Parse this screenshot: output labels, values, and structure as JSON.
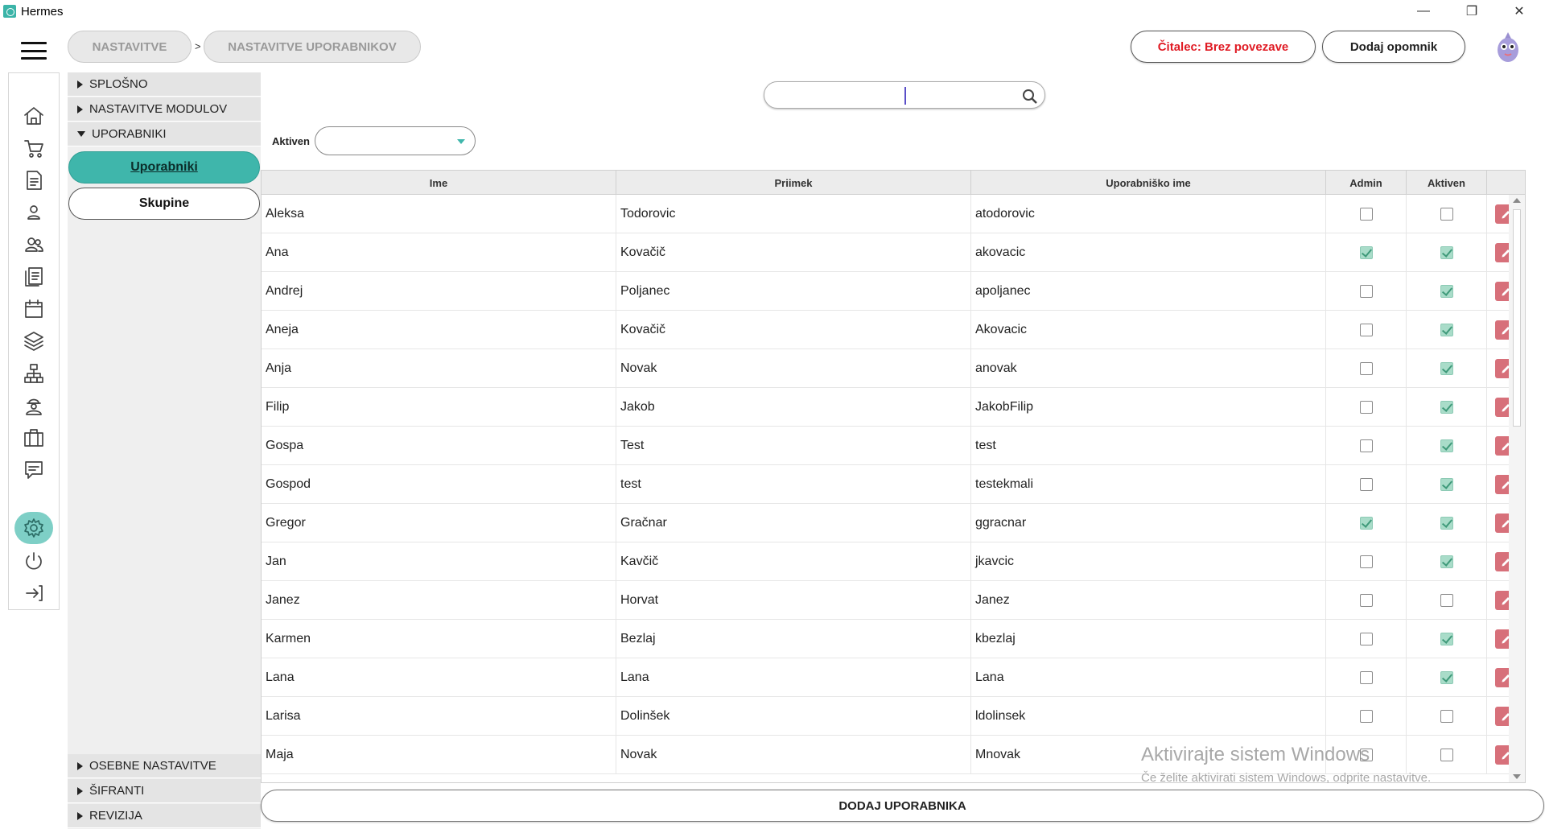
{
  "window": {
    "title": "Hermes"
  },
  "header": {
    "breadcrumb": [
      "NASTAVITVE",
      "NASTAVITVE UPORABNIKOV"
    ],
    "separator": ">",
    "reader_status": "Čitalec: Brez povezave",
    "add_reminder": "Dodaj opomnik"
  },
  "rail": {
    "icons": [
      "home-icon",
      "cart-icon",
      "document-icon",
      "user-icon",
      "users-icon",
      "list-icon",
      "calendar-icon",
      "layers-icon",
      "network-icon",
      "worker-icon",
      "briefcase-icon",
      "chat-icon",
      "gear-icon",
      "power-icon",
      "logout-icon"
    ],
    "active": "gear-icon"
  },
  "menu": {
    "sections_top": [
      "SPLOŠNO",
      "NASTAVITVE MODULOV",
      "UPORABNIKI"
    ],
    "expanded": "UPORABNIKI",
    "sub_items": [
      "Uporabniki",
      "Skupine"
    ],
    "active_sub": "Uporabniki",
    "sections_bottom": [
      "OSEBNE NASTAVITVE",
      "ŠIFRANTI",
      "REVIZIJA"
    ]
  },
  "filters": {
    "search_value": "",
    "aktiven_label": "Aktiven",
    "aktiven_value": ""
  },
  "table": {
    "columns": [
      "Ime",
      "Priimek",
      "Uporabniško ime",
      "Admin",
      "Aktiven"
    ],
    "rows": [
      {
        "ime": "Aleksa",
        "priimek": "Todorovic",
        "uporabnisko_ime": "atodorovic",
        "admin": false,
        "aktiven": false
      },
      {
        "ime": "Ana",
        "priimek": "Kovačič",
        "uporabnisko_ime": "akovacic",
        "admin": true,
        "aktiven": true
      },
      {
        "ime": "Andrej",
        "priimek": "Poljanec",
        "uporabnisko_ime": "apoljanec",
        "admin": false,
        "aktiven": true
      },
      {
        "ime": "Aneja",
        "priimek": "Kovačič",
        "uporabnisko_ime": "Akovacic",
        "admin": false,
        "aktiven": true
      },
      {
        "ime": "Anja",
        "priimek": "Novak",
        "uporabnisko_ime": "anovak",
        "admin": false,
        "aktiven": true
      },
      {
        "ime": "Filip",
        "priimek": "Jakob",
        "uporabnisko_ime": "JakobFilip",
        "admin": false,
        "aktiven": true
      },
      {
        "ime": "Gospa",
        "priimek": "Test",
        "uporabnisko_ime": "test",
        "admin": false,
        "aktiven": true
      },
      {
        "ime": "Gospod",
        "priimek": "test",
        "uporabnisko_ime": "testekmali",
        "admin": false,
        "aktiven": true
      },
      {
        "ime": "Gregor",
        "priimek": "Gračnar",
        "uporabnisko_ime": "ggracnar",
        "admin": true,
        "aktiven": true
      },
      {
        "ime": "Jan",
        "priimek": "Kavčič",
        "uporabnisko_ime": "jkavcic",
        "admin": false,
        "aktiven": true
      },
      {
        "ime": "Janez",
        "priimek": "Horvat",
        "uporabnisko_ime": "Janez",
        "admin": false,
        "aktiven": false
      },
      {
        "ime": "Karmen",
        "priimek": "Bezlaj",
        "uporabnisko_ime": "kbezlaj",
        "admin": false,
        "aktiven": true
      },
      {
        "ime": "Lana",
        "priimek": "Lana",
        "uporabnisko_ime": "Lana",
        "admin": false,
        "aktiven": true
      },
      {
        "ime": "Larisa",
        "priimek": "Dolinšek",
        "uporabnisko_ime": "ldolinsek",
        "admin": false,
        "aktiven": false
      },
      {
        "ime": "Maja",
        "priimek": "Novak",
        "uporabnisko_ime": "Mnovak",
        "admin": false,
        "aktiven": false
      }
    ]
  },
  "add_user_label": "DODAJ UPORABNIKA",
  "watermark": {
    "line1": "Aktivirajte sistem Windows",
    "line2": "Če želite aktivirati sistem Windows, odprite nastavitve."
  },
  "colors": {
    "accent": "#3fb6ab",
    "edit": "#d7707a",
    "reader_status": "#e01b24"
  }
}
